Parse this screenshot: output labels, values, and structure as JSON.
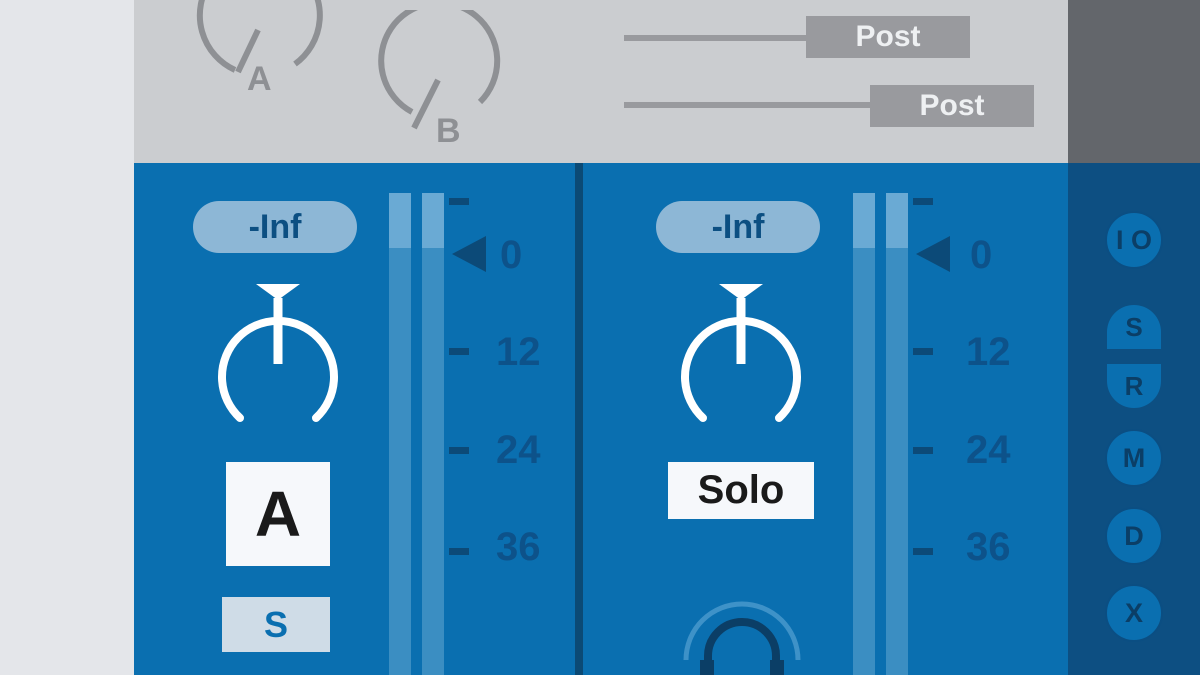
{
  "sends": {
    "knob_a_label": "A",
    "knob_b_label": "B",
    "send_a_mode": "Post",
    "send_b_mode": "Post"
  },
  "channels": [
    {
      "volume": "-Inf",
      "track_label": "A",
      "solo_label": "S",
      "meter_scale": [
        "0",
        "12",
        "24",
        "36"
      ]
    },
    {
      "volume": "-Inf",
      "track_label": "Solo",
      "meter_scale": [
        "0",
        "12",
        "24",
        "36"
      ]
    }
  ],
  "io_panel": {
    "buttons": [
      "I O",
      "S",
      "R",
      "M",
      "D",
      "X"
    ]
  },
  "colors": {
    "channel_blue": "#0a6fb0",
    "io_panel": "#0d4f82",
    "sends_bg": "#cbcdd0",
    "dark_corner": "#63666b"
  },
  "icons": [
    "pan-knob-icon",
    "send-knob-icon",
    "headphones-icon",
    "meter-pointer-icon"
  ]
}
